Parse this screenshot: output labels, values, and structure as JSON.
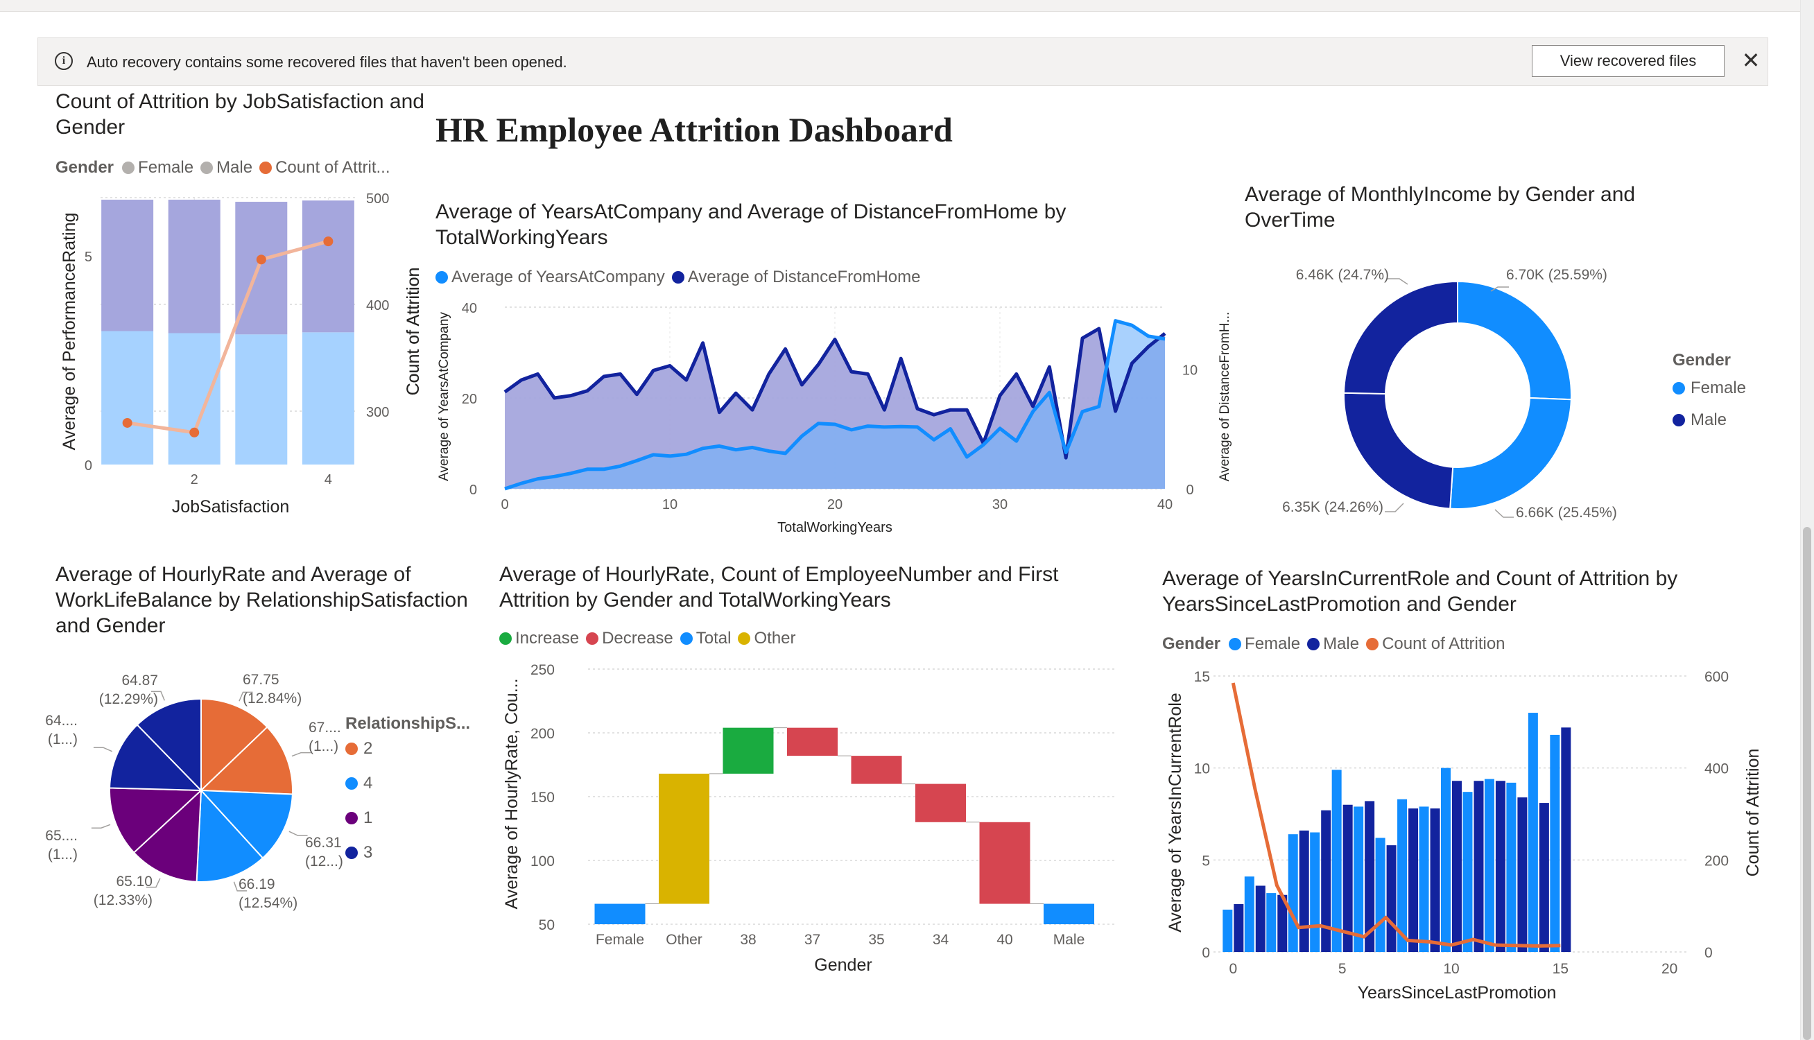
{
  "banner": {
    "message": "Auto recovery contains some recovered files that haven't been opened.",
    "button_label": "View recovered files",
    "close_glyph": "✕",
    "info_glyph": "i",
    "icons": [
      "info-icon",
      "close-icon"
    ]
  },
  "dashboard_title": "HR Employee Attrition Dashboard",
  "colors": {
    "light_blue": "#118DFF",
    "dark_blue": "#12239E",
    "orange": "#E66C37",
    "purple": "#6B007B",
    "gray": "#b3b0ad",
    "increase": "#1AAB40",
    "decrease": "#D64550",
    "total": "#118DFF",
    "other": "#D9B300"
  },
  "chart_data": [
    {
      "id": "chart1",
      "type": "bar",
      "title": "Count of Attrition by JobSatisfaction and Gender",
      "legend": {
        "title": "Gender",
        "items": [
          "Female",
          "Male",
          "Count of Attrit..."
        ]
      },
      "xlabel": "JobSatisfaction",
      "ylabel": "Average of PerformanceRating",
      "y2label": "Count of Attrition",
      "categories": [
        1,
        2,
        3,
        4
      ],
      "x_ticks": [
        "2",
        "4"
      ],
      "ylim": [
        0,
        6.4
      ],
      "y_ticks": [
        "0",
        "5"
      ],
      "y2lim": [
        250,
        500
      ],
      "y2_ticks": [
        "300",
        "400",
        "500"
      ],
      "series": [
        {
          "name": "Female",
          "values": [
            3.2,
            3.15,
            3.12,
            3.17
          ]
        },
        {
          "name": "Male",
          "values": [
            3.15,
            3.2,
            3.18,
            3.16
          ]
        },
        {
          "name": "Count of Attrit...",
          "values": [
            289,
            280,
            442,
            459
          ]
        }
      ]
    },
    {
      "id": "chart2",
      "type": "area",
      "title": "Average of YearsAtCompany and Average of DistanceFromHome by TotalWorkingYears",
      "legend": {
        "items": [
          "Average of YearsAtCompany",
          "Average of DistanceFromHome"
        ]
      },
      "xlabel": "TotalWorkingYears",
      "ylabel": "Average of YearsAtCompany",
      "y2label": "Average of DistanceFromH...",
      "y2tick_label": "Count of Attrition",
      "xlim": [
        0,
        40
      ],
      "x_ticks": [
        "0",
        "10",
        "20",
        "30",
        "40"
      ],
      "ylim": [
        0,
        40
      ],
      "y_ticks": [
        "0",
        "20",
        "40"
      ],
      "y2lim": [
        0,
        15.2
      ],
      "y2_ticks": [
        "0",
        "10"
      ],
      "x": [
        0,
        1,
        2,
        3,
        4,
        5,
        6,
        7,
        8,
        9,
        10,
        11,
        12,
        13,
        14,
        15,
        16,
        17,
        18,
        19,
        20,
        21,
        22,
        23,
        24,
        25,
        26,
        27,
        28,
        29,
        30,
        31,
        32,
        33,
        34,
        35,
        36,
        37,
        38,
        39,
        40
      ],
      "series": [
        {
          "name": "Average of YearsAtCompany",
          "values": [
            0,
            1.2,
            2.2,
            2.7,
            3.4,
            4.3,
            4.3,
            5.0,
            6.2,
            7.5,
            7.2,
            7.6,
            8.9,
            9.4,
            8.6,
            9.1,
            8.3,
            7.8,
            11.6,
            14.4,
            14.2,
            13.0,
            13.8,
            13.6,
            13.7,
            13.6,
            10.8,
            13.2,
            7.0,
            9.7,
            13.3,
            10.5,
            17.0,
            21.2,
            8.0,
            17.0,
            18.1,
            37.0,
            36.0,
            33.6,
            33.0
          ]
        },
        {
          "name": "Average of DistanceFromHome",
          "values": [
            8.1,
            9.1,
            9.6,
            7.6,
            7.8,
            8.2,
            9.4,
            9.6,
            7.9,
            9.9,
            10.3,
            9.1,
            12.2,
            6.4,
            8.0,
            6.6,
            9.6,
            11.7,
            8.7,
            10.4,
            12.5,
            9.8,
            9.6,
            6.6,
            10.9,
            6.7,
            6.2,
            6.6,
            6.6,
            3.8,
            7.8,
            9.6,
            6.9,
            10.2,
            2.6,
            12.6,
            13.4,
            6.5,
            10.5,
            11.9,
            13.0
          ]
        }
      ]
    },
    {
      "id": "chart3",
      "type": "pie",
      "title": "Average of MonthlyIncome by Gender and OverTime",
      "legend": {
        "title": "Gender",
        "items": [
          "Female",
          "Male"
        ]
      },
      "slices": [
        {
          "label": "6.70K (25.59%)",
          "value": 6.7,
          "color": "light_blue"
        },
        {
          "label": "6.66K (25.45%)",
          "value": 6.66,
          "color": "light_blue"
        },
        {
          "label": "6.35K (24.26%)",
          "value": 6.35,
          "color": "dark_blue"
        },
        {
          "label": "6.46K (24.7%)",
          "value": 6.46,
          "color": "dark_blue"
        }
      ]
    },
    {
      "id": "chart4",
      "type": "pie",
      "title": "Average of HourlyRate and Average of WorkLifeBalance by RelationshipSatisfaction and Gender",
      "legend": {
        "title": "RelationshipS...",
        "items": [
          "2",
          "4",
          "1",
          "3"
        ]
      },
      "slices": [
        {
          "value": 67.75,
          "label": [
            "67.75",
            "(12.84%)"
          ],
          "color": "orange"
        },
        {
          "value": 67.7,
          "label": [
            "67....",
            "(1...)"
          ],
          "color": "orange"
        },
        {
          "value": 66.31,
          "label": [
            "66.31",
            "(12...)"
          ],
          "color": "light_blue"
        },
        {
          "value": 66.19,
          "label": [
            "66.19",
            "(12.54%)"
          ],
          "color": "light_blue"
        },
        {
          "value": 65.1,
          "label": [
            "65.10",
            "(12.33%)"
          ],
          "color": "purple"
        },
        {
          "value": 65.0,
          "label": [
            "65....",
            "(1...)"
          ],
          "color": "purple"
        },
        {
          "value": 64.8,
          "label": [
            "64....",
            "(1...)"
          ],
          "color": "dark_blue"
        },
        {
          "value": 64.87,
          "label": [
            "64.87",
            "(12.29%)"
          ],
          "color": "dark_blue"
        }
      ]
    },
    {
      "id": "chart5",
      "type": "bar",
      "title": "Average of HourlyRate, Count of EmployeeNumber and First Attrition by Gender and TotalWorkingYears",
      "legend": {
        "items": [
          "Increase",
          "Decrease",
          "Total",
          "Other"
        ]
      },
      "xlabel": "Gender",
      "ylabel": "Average of HourlyRate, Cou...",
      "ylim": [
        50,
        250
      ],
      "y_ticks": [
        "50",
        "100",
        "150",
        "200",
        "250"
      ],
      "categories": [
        "Female",
        "Other",
        "38",
        "37",
        "35",
        "34",
        "40",
        "Male"
      ],
      "steps": [
        {
          "kind": "Total",
          "from": 50,
          "to": 66
        },
        {
          "kind": "Other",
          "from": 66,
          "to": 168
        },
        {
          "kind": "Increase",
          "from": 168,
          "to": 204
        },
        {
          "kind": "Decrease",
          "from": 204,
          "to": 182
        },
        {
          "kind": "Decrease",
          "from": 182,
          "to": 160
        },
        {
          "kind": "Decrease",
          "from": 160,
          "to": 130
        },
        {
          "kind": "Decrease",
          "from": 130,
          "to": 66
        },
        {
          "kind": "Total",
          "from": 50,
          "to": 66
        }
      ]
    },
    {
      "id": "chart6",
      "type": "bar",
      "title": "Average of YearsInCurrentRole and Count of Attrition by YearsSinceLastPromotion and Gender",
      "legend": {
        "title": "Gender",
        "items": [
          "Female",
          "Male",
          "Count of Attrition"
        ]
      },
      "xlabel": "YearsSinceLastPromotion",
      "ylabel": "Average of YearsInCurrentRole",
      "y2label": "Count of Attrition",
      "xlim": [
        -0.9,
        20.9
      ],
      "x_ticks": [
        "0",
        "5",
        "10",
        "15",
        "20"
      ],
      "ylim": [
        0,
        15
      ],
      "y_ticks": [
        "0",
        "5",
        "10",
        "15"
      ],
      "y2lim": [
        0,
        600
      ],
      "y2_ticks": [
        "0",
        "200",
        "400",
        "600"
      ],
      "x": [
        0,
        1,
        2,
        3,
        4,
        5,
        6,
        7,
        8,
        9,
        10,
        11,
        12,
        13,
        14,
        15
      ],
      "series": [
        {
          "name": "Female",
          "values": [
            2.3,
            4.1,
            3.2,
            6.4,
            6.5,
            9.9,
            7.9,
            6.2,
            8.3,
            7.9,
            10.0,
            8.7,
            9.4,
            9.2,
            13.0,
            11.8
          ]
        },
        {
          "name": "Male",
          "values": [
            2.6,
            3.6,
            3.1,
            6.6,
            7.7,
            8.0,
            8.2,
            5.8,
            7.8,
            7.8,
            9.3,
            9.3,
            9.3,
            8.4,
            8.1,
            12.2
          ]
        },
        {
          "name": "Count of Attrition",
          "values": [
            585,
            355,
            145,
            53,
            57,
            45,
            33,
            75,
            25,
            22,
            15,
            27,
            15,
            14,
            13,
            14
          ]
        }
      ]
    }
  ]
}
